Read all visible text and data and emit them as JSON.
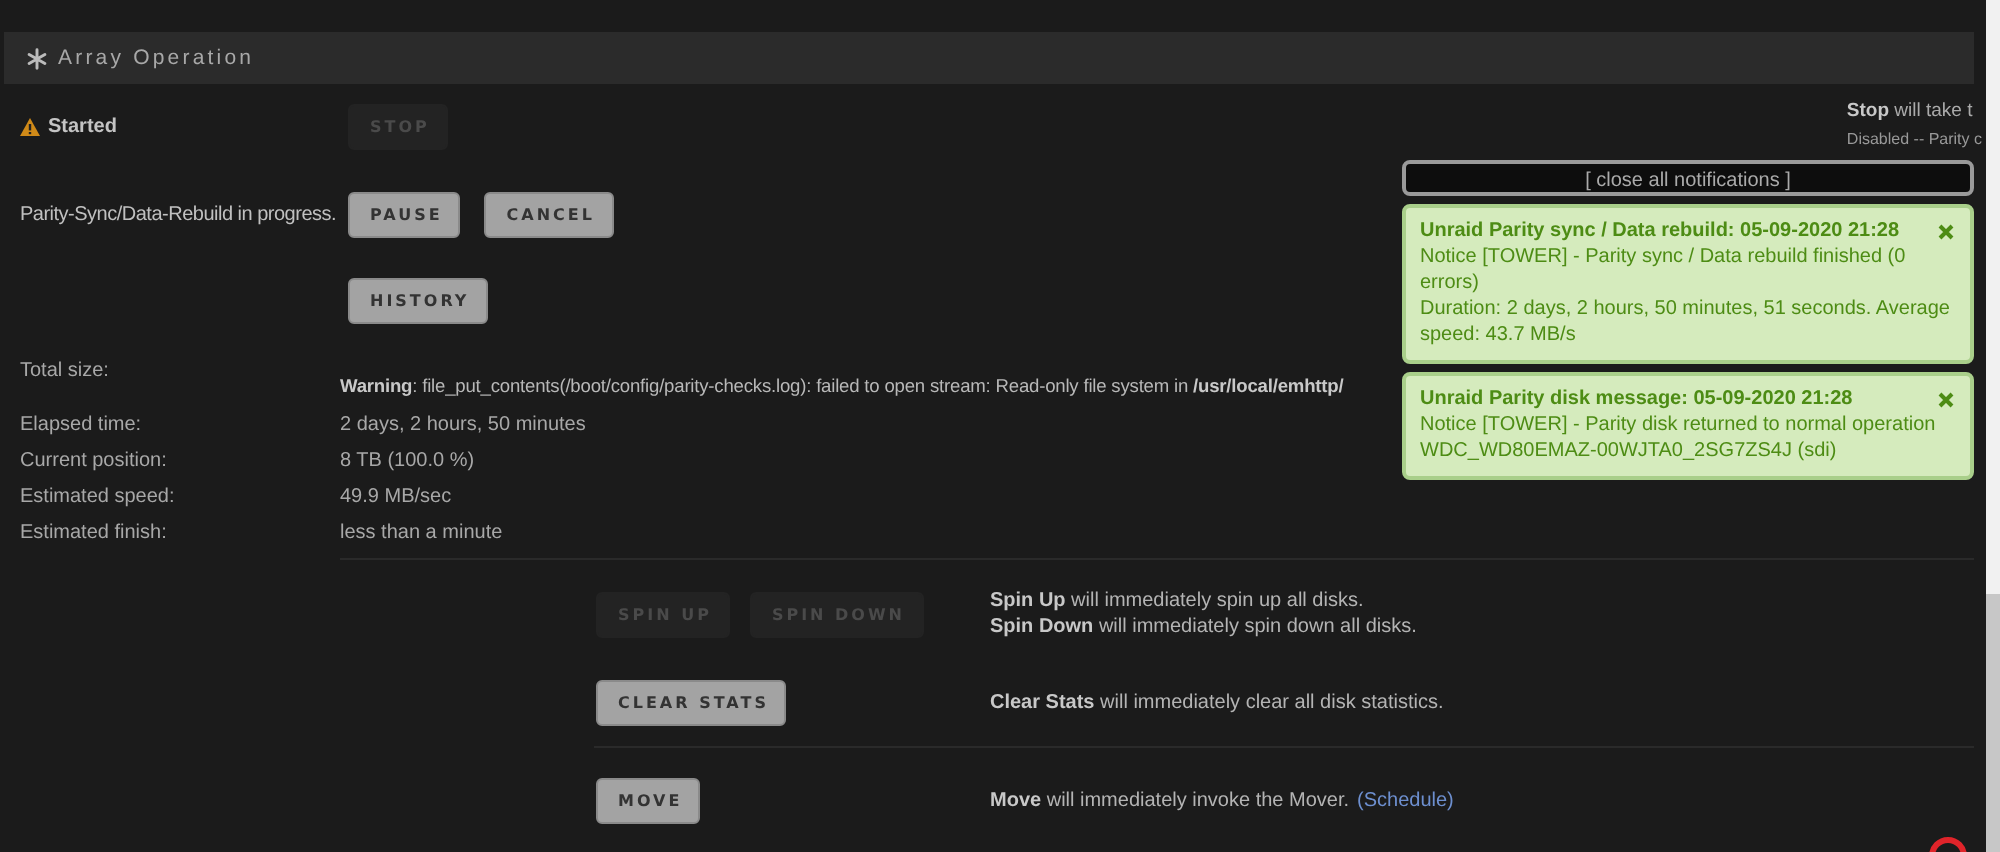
{
  "section": {
    "title": "Array Operation"
  },
  "status": {
    "label": "Started",
    "button": {
      "label": "STOP",
      "disabled": true
    },
    "help": [
      {
        "kind": "main",
        "text": "**Stop** will take t"
      },
      {
        "kind": "note",
        "text": "Disabled -- Parity c"
      }
    ]
  },
  "progress": {
    "label": "Parity-Sync/Data-Rebuild in progress.",
    "buttons": [
      {
        "label": "PAUSE",
        "disabled": false
      },
      {
        "label": "CANCEL",
        "disabled": false
      }
    ]
  },
  "history_button": {
    "label": "HISTORY",
    "disabled": false
  },
  "warning": "**Warning**: file_put_contents(/boot/config/parity-checks.log): failed to open stream: Read-only file system in **/usr/local/emhttp/**",
  "stats": [
    {
      "label": "Total size:"
    },
    {
      "label": "Elapsed time:",
      "value": "2 days, 2 hours, 50 minutes"
    },
    {
      "label": "Current position:",
      "value": "8 TB (100.0 %)"
    },
    {
      "label": "Estimated speed:",
      "value": "49.9 MB/sec"
    },
    {
      "label": "Estimated finish:",
      "value": "less than a minute"
    }
  ],
  "actions": [
    {
      "separated": false,
      "buttons": [
        {
          "label": "SPIN UP",
          "disabled": true
        },
        {
          "label": "SPIN DOWN",
          "disabled": true
        }
      ],
      "help": [
        "**Spin Up** will immediately spin up all disks.",
        "**Spin Down** will immediately spin down all disks."
      ]
    },
    {
      "separated": false,
      "buttons": [
        {
          "label": "CLEAR STATS",
          "disabled": false
        }
      ],
      "help": [
        "**Clear Stats** will immediately clear all disk statistics."
      ]
    },
    {
      "separated": true,
      "buttons": [
        {
          "label": "MOVE",
          "disabled": false
        }
      ],
      "help": [
        "**Move** will immediately invoke the Mover."
      ],
      "link": "(Schedule)"
    }
  ],
  "notifications": {
    "close_all": "[ close all notifications ]",
    "items": [
      {
        "title": "Unraid Parity sync / Data rebuild: 05-09-2020 21:28",
        "lines": [
          "Notice [TOWER] - Parity sync / Data rebuild finished (0 errors)",
          "Duration: 2 days, 2 hours, 50 minutes, 51 seconds. Average speed: 43.7 MB/s"
        ]
      },
      {
        "title": "Unraid Parity disk message: 05-09-2020 21:28",
        "lines": [
          "Notice [TOWER] - Parity disk returned to normal operation",
          "WDC_WD80EMAZ-00WJTA0_2SG7ZS4J (sdi)"
        ]
      }
    ]
  }
}
